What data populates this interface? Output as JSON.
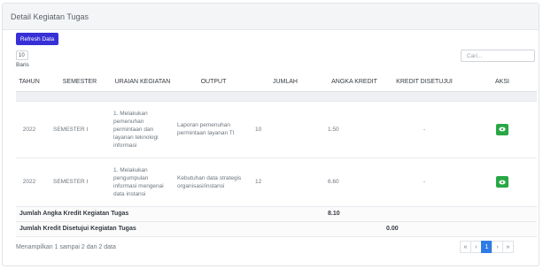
{
  "card": {
    "title": "Detail Kegiatan Tugas"
  },
  "toolbar": {
    "refresh_label": "Refresh Data"
  },
  "length": {
    "value": "10",
    "label": "Baris"
  },
  "search": {
    "placeholder": "Cari..."
  },
  "table": {
    "headers": [
      "TAHUN",
      "SEMESTER",
      "URAIAN KEGIATAN",
      "OUTPUT",
      "JUMLAH",
      "ANGKA KREDIT",
      "KREDIT DISETUJUI",
      "AKSI"
    ],
    "rows": [
      {
        "tahun": "2022",
        "semester": "SEMESTER I",
        "uraian": "1. Melakukan pemenuhan permintaan dan layanan teknologi informasi",
        "output": "Laporan pemenuhan permintaan layanan TI",
        "jumlah": "10",
        "angka_kredit": "1.50",
        "kredit_disetujui": "-"
      },
      {
        "tahun": "2022",
        "semester": "SEMESTER I",
        "uraian": "1. Melakukan pengumpulan informasi mengenai data instansi",
        "output": "Kebutuhan data strategis organisasi/instansi",
        "jumlah": "12",
        "angka_kredit": "6.60",
        "kredit_disetujui": "-"
      }
    ],
    "summary": [
      {
        "label": "Jumlah Angka Kredit Kegiatan Tugas",
        "value": "8.10"
      },
      {
        "label": "Jumlah Kredit Disetujui Kegiatan Tugas",
        "value": "0.00"
      }
    ]
  },
  "footer": {
    "info": "Menampilkan 1 sampai 2 dari 2 data",
    "pages": [
      "«",
      "‹",
      "1",
      "›",
      "»"
    ]
  },
  "colors": {
    "primary": "#3730d6",
    "success": "#28a745",
    "page_active": "#2f7be5"
  },
  "icons": {
    "action": "eye-icon"
  }
}
